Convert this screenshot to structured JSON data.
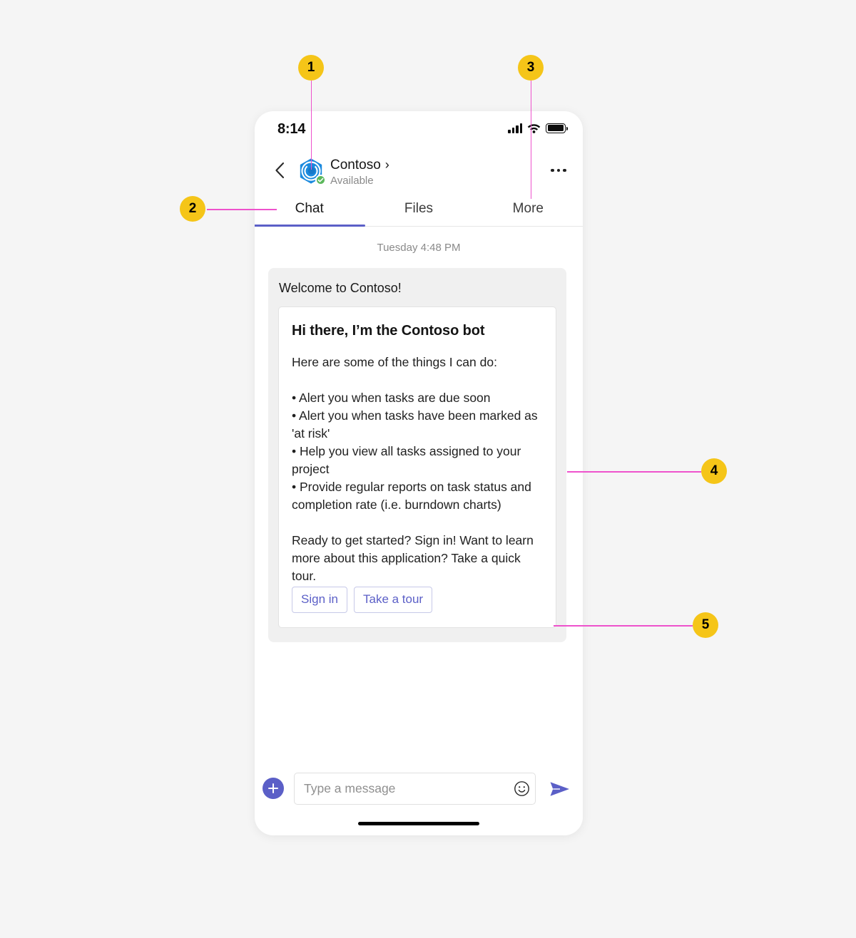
{
  "phone": {
    "status_bar": {
      "time": "8:14",
      "signal_icon": "signal-bars-icon",
      "wifi_icon": "wifi-icon",
      "battery_icon": "battery-icon"
    },
    "header": {
      "back_icon": "back-chevron-icon",
      "avatar_icon": "contoso-logo-icon",
      "presence_icon": "available-check-icon",
      "name": "Contoso",
      "name_chevron": "›",
      "presence_label": "Available",
      "more_icon": "more-options-icon"
    },
    "tabs": [
      {
        "label": "Chat",
        "active": true
      },
      {
        "label": "Files",
        "active": false
      },
      {
        "label": "More",
        "active": false
      }
    ],
    "chat": {
      "timestamp": "Tuesday 4:48 PM",
      "bubble_title": "Welcome to Contoso!",
      "card": {
        "heading": "Hi there, I’m the Contoso bot",
        "intro": "Here are some of the things I can do:",
        "bullets": [
          "• Alert you when tasks are due soon",
          "• Alert you when tasks have been marked as 'at risk'",
          "• Help you view all tasks assigned to your project",
          "• Provide regular reports on task status and completion rate  (i.e. burndown charts)"
        ],
        "outro": "Ready to get started? Sign in! Want to learn more about this application? Take a quick tour.",
        "actions": [
          {
            "label": "Sign in"
          },
          {
            "label": "Take a tour"
          }
        ]
      }
    },
    "composer": {
      "add_icon": "plus-icon",
      "placeholder": "Type a message",
      "value": "",
      "emoji_icon": "emoji-smiley-icon",
      "send_icon": "send-arrow-icon",
      "home_indicator": "home-indicator"
    }
  },
  "callouts": [
    {
      "number": "1"
    },
    {
      "number": "2"
    },
    {
      "number": "3"
    },
    {
      "number": "4"
    },
    {
      "number": "5"
    }
  ],
  "colors": {
    "accent_purple": "#5b5fc7",
    "badge_yellow": "#f5c518",
    "leader_pink": "#ee52cc",
    "logo_blue": "#1b8ade",
    "presence_green": "#5cb85c",
    "page_background": "#f5f5f5"
  }
}
